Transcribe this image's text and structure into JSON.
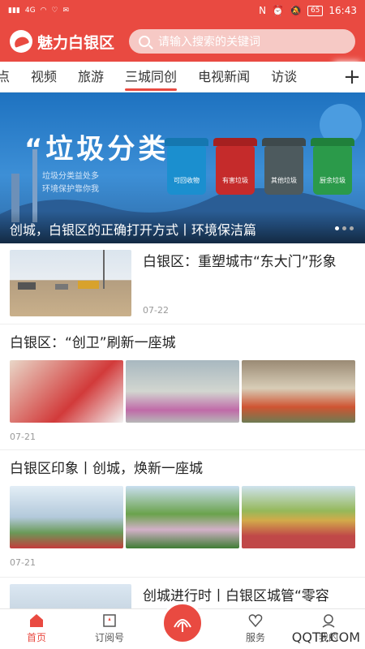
{
  "status": {
    "time": "16:43",
    "battery": "65",
    "network": "4G"
  },
  "header": {
    "app_name": "魅力白银区",
    "search_placeholder": "请输入搜索的关键词"
  },
  "tabs": [
    "点",
    "视频",
    "旅游",
    "三城同创",
    "电视新闻",
    "访谈"
  ],
  "banner": {
    "headline": "“垃圾分类”",
    "sub1": "垃圾分类益处多",
    "sub2": "环境保护靠你我",
    "bins": [
      "可回收物",
      "有害垃圾",
      "其他垃圾",
      "厨余垃圾"
    ],
    "caption": "创城，白银区的正确打开方式丨环境保洁篇"
  },
  "feed": [
    {
      "title": "白银区：重塑城市“东大门”形象",
      "date": "07-22"
    },
    {
      "title": "白银区：“创卫”刷新一座城",
      "date": "07-21"
    },
    {
      "title": "白银区印象丨创城，焕新一座城",
      "date": "07-21"
    },
    {
      "title": "创城进行时丨白银区城管“零容",
      "date": ""
    }
  ],
  "bottom_nav": {
    "home": "首页",
    "subscribe": "订阅号",
    "service": "服务",
    "mine": "我的"
  },
  "watermark": "QQTF.COM",
  "colors": {
    "brand": "#e94a41"
  }
}
